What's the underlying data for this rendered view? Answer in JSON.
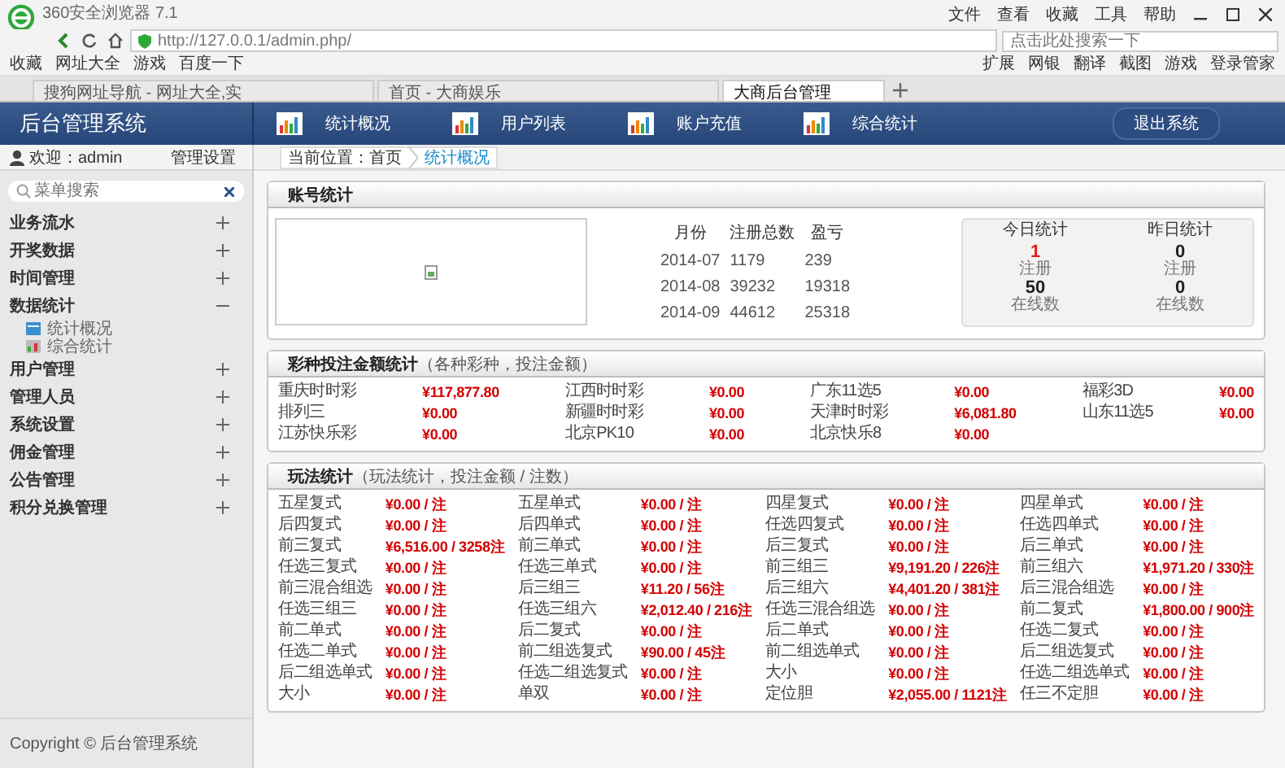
{
  "browser": {
    "title": "360安全浏览器 7.1",
    "menu": [
      "文件",
      "查看",
      "收藏",
      "工具",
      "帮助"
    ],
    "address": "http://127.0.0.1/admin.php/",
    "search_placeholder": "点击此处搜索一下",
    "bookmarks": [
      "收藏",
      "网址大全",
      "游戏",
      "百度一下"
    ],
    "toolbar": [
      "扩展",
      "网银",
      "翻译",
      "截图",
      "游戏",
      "登录管家"
    ],
    "tabs": [
      {
        "label": "搜狗网址导航 - 网址大全,实",
        "selected": false
      },
      {
        "label": "首页 - 大商娱乐",
        "selected": false
      },
      {
        "label": "大商后台管理",
        "selected": true
      }
    ]
  },
  "header": {
    "title": "后台管理系统",
    "nav": [
      "统计概况",
      "用户列表",
      "账户充值",
      "综合统计"
    ],
    "logout": "退出系统"
  },
  "sidebar": {
    "user": "欢迎：admin",
    "settings": "管理设置",
    "search_placeholder": "菜单搜索",
    "menu": [
      {
        "label": "业务流水",
        "expanded": false
      },
      {
        "label": "开奖数据",
        "expanded": false
      },
      {
        "label": "时间管理",
        "expanded": false
      },
      {
        "label": "数据统计",
        "expanded": true,
        "children": [
          {
            "label": "统计概况"
          },
          {
            "label": "综合统计"
          }
        ]
      },
      {
        "label": "用户管理",
        "expanded": false
      },
      {
        "label": "管理人员",
        "expanded": false
      },
      {
        "label": "系统设置",
        "expanded": false
      },
      {
        "label": "佣金管理",
        "expanded": false
      },
      {
        "label": "公告管理",
        "expanded": false
      },
      {
        "label": "积分兑换管理",
        "expanded": false
      }
    ],
    "copyright": "Copyright © 后台管理系统"
  },
  "breadcrumb": {
    "location": "当前位置：首页",
    "current": "统计概况"
  },
  "account_panel": {
    "title": "账号统计",
    "table": {
      "columns": [
        "月份",
        "注册总数",
        "盈亏"
      ],
      "rows": [
        [
          "2014-07",
          "1179",
          "239"
        ],
        [
          "2014-08",
          "39232",
          "19318"
        ],
        [
          "2014-09",
          "44612",
          "25318"
        ]
      ]
    },
    "today": {
      "title": "今日统计",
      "items": [
        {
          "value": "1",
          "label": "注册",
          "alert": true
        },
        {
          "value": "50",
          "label": "在线数",
          "alert": false
        }
      ]
    },
    "yesterday": {
      "title": "昨日统计",
      "items": [
        {
          "value": "0",
          "label": "注册",
          "alert": false
        },
        {
          "value": "0",
          "label": "在线数",
          "alert": false
        }
      ]
    }
  },
  "lottery_panel": {
    "title": "彩种投注金额统计",
    "subtitle": "（各种彩种，投注金额）",
    "items": [
      {
        "name": "重庆时时彩",
        "amount": "¥117,877.80"
      },
      {
        "name": "江西时时彩",
        "amount": "¥0.00"
      },
      {
        "name": "广东11选5",
        "amount": "¥0.00"
      },
      {
        "name": "福彩3D",
        "amount": "¥0.00"
      },
      {
        "name": "排列三",
        "amount": "¥0.00"
      },
      {
        "name": "新疆时时彩",
        "amount": "¥0.00"
      },
      {
        "name": "天津时时彩",
        "amount": "¥6,081.80"
      },
      {
        "name": "山东11选5",
        "amount": "¥0.00"
      },
      {
        "name": "江苏快乐彩",
        "amount": "¥0.00"
      },
      {
        "name": "北京PK10",
        "amount": "¥0.00"
      },
      {
        "name": "北京快乐8",
        "amount": "¥0.00"
      }
    ]
  },
  "play_panel": {
    "title": "玩法统计",
    "subtitle": "（玩法统计，投注金额 / 注数）",
    "items": [
      {
        "name": "五星复式",
        "amount": "¥0.00 / 注"
      },
      {
        "name": "五星单式",
        "amount": "¥0.00 / 注"
      },
      {
        "name": "四星复式",
        "amount": "¥0.00 / 注"
      },
      {
        "name": "四星单式",
        "amount": "¥0.00 / 注"
      },
      {
        "name": "后四复式",
        "amount": "¥0.00 / 注"
      },
      {
        "name": "后四单式",
        "amount": "¥0.00 / 注"
      },
      {
        "name": "任选四复式",
        "amount": "¥0.00 / 注"
      },
      {
        "name": "任选四单式",
        "amount": "¥0.00 / 注"
      },
      {
        "name": "前三复式",
        "amount": "¥6,516.00 / 3258注"
      },
      {
        "name": "前三单式",
        "amount": "¥0.00 / 注"
      },
      {
        "name": "后三复式",
        "amount": "¥0.00 / 注"
      },
      {
        "name": "后三单式",
        "amount": "¥0.00 / 注"
      },
      {
        "name": "任选三复式",
        "amount": "¥0.00 / 注"
      },
      {
        "name": "任选三单式",
        "amount": "¥0.00 / 注"
      },
      {
        "name": "前三组三",
        "amount": "¥9,191.20 / 226注"
      },
      {
        "name": "前三组六",
        "amount": "¥1,971.20 / 330注"
      },
      {
        "name": "前三混合组选",
        "amount": "¥0.00 / 注"
      },
      {
        "name": "后三组三",
        "amount": "¥11.20 / 56注"
      },
      {
        "name": "后三组六",
        "amount": "¥4,401.20 / 381注"
      },
      {
        "name": "后三混合组选",
        "amount": "¥0.00 / 注"
      },
      {
        "name": "任选三组三",
        "amount": "¥0.00 / 注"
      },
      {
        "name": "任选三组六",
        "amount": "¥2,012.40 / 216注"
      },
      {
        "name": "任选三混合组选",
        "amount": "¥0.00 / 注"
      },
      {
        "name": "前二复式",
        "amount": "¥1,800.00 / 900注"
      },
      {
        "name": "前二单式",
        "amount": "¥0.00 / 注"
      },
      {
        "name": "后二复式",
        "amount": "¥0.00 / 注"
      },
      {
        "name": "后二单式",
        "amount": "¥0.00 / 注"
      },
      {
        "name": "任选二复式",
        "amount": "¥0.00 / 注"
      },
      {
        "name": "任选二单式",
        "amount": "¥0.00 / 注"
      },
      {
        "name": "前二组选复式",
        "amount": "¥90.00 / 45注"
      },
      {
        "name": "前二组选单式",
        "amount": "¥0.00 / 注"
      },
      {
        "name": "后二组选复式",
        "amount": "¥0.00 / 注"
      },
      {
        "name": "后二组选单式",
        "amount": "¥0.00 / 注"
      },
      {
        "name": "任选二组选复式",
        "amount": "¥0.00 / 注"
      },
      {
        "name": "大小",
        "amount": "¥0.00 / 注"
      },
      {
        "name": "任选二组选单式",
        "amount": "¥0.00 / 注"
      },
      {
        "name": "大小",
        "amount": "¥0.00 / 注"
      },
      {
        "name": "单双",
        "amount": "¥0.00 / 注"
      },
      {
        "name": "定位胆",
        "amount": "¥2,055.00 / 1121注"
      },
      {
        "name": "任三不定胆",
        "amount": "¥0.00 / 注"
      }
    ]
  }
}
